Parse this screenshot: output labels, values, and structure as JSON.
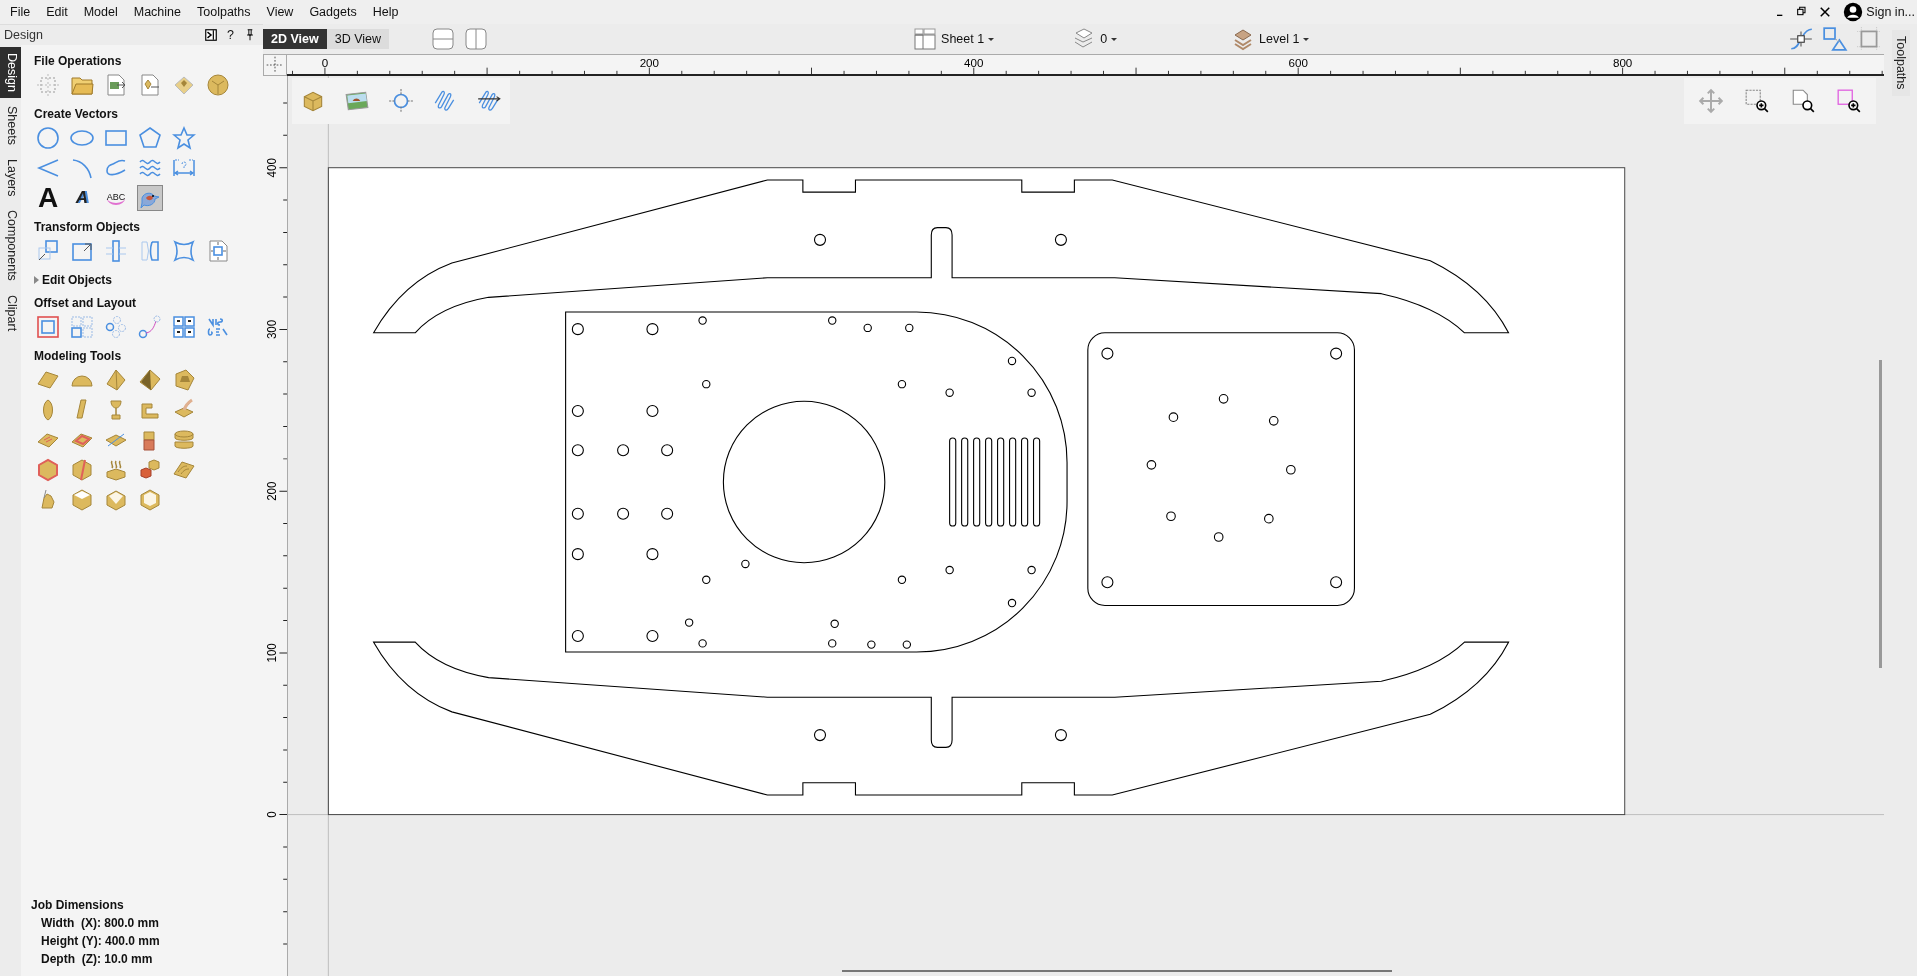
{
  "menu": [
    "File",
    "Edit",
    "Model",
    "Machine",
    "Toolpaths",
    "View",
    "Gadgets",
    "Help"
  ],
  "account": {
    "label": "Sign in..."
  },
  "panel": {
    "title": "Design",
    "help": "?",
    "side_tabs": [
      {
        "label": "Design",
        "selected": true
      },
      {
        "label": "Sheets",
        "selected": false
      },
      {
        "label": "Layers",
        "selected": false
      },
      {
        "label": "Components",
        "selected": false
      },
      {
        "label": "Clipart",
        "selected": false
      }
    ],
    "sections": [
      {
        "title": "File Operations",
        "tools": [
          {
            "selected": false
          },
          {
            "selected": false
          },
          {
            "selected": false
          },
          {
            "selected": false
          },
          {
            "selected": false
          },
          {
            "selected": false
          }
        ]
      },
      {
        "title": "Create Vectors",
        "tools": [
          {
            "selected": false
          },
          {
            "selected": false
          },
          {
            "selected": false
          },
          {
            "selected": false
          },
          {
            "selected": false
          },
          {
            "selected": false
          },
          {
            "selected": false
          },
          {
            "selected": false
          },
          {
            "selected": false
          },
          {
            "selected": false
          },
          {
            "glyph": "A",
            "selected": false
          },
          {
            "glyph": "A",
            "selected": false
          },
          {
            "glyph": "ABC",
            "selected": false
          },
          {
            "selected": true
          }
        ]
      },
      {
        "title": "Transform Objects",
        "tools": [
          {
            "selected": false
          },
          {
            "selected": false
          },
          {
            "selected": false
          },
          {
            "selected": false
          },
          {
            "selected": false
          },
          {
            "selected": false
          }
        ]
      },
      {
        "title": "Edit Objects",
        "expanded": false
      },
      {
        "title": "Offset and Layout",
        "tools": [
          {
            "selected": false
          },
          {
            "selected": false
          },
          {
            "selected": false
          },
          {
            "selected": false
          },
          {
            "selected": false
          },
          {
            "selected": false
          }
        ]
      },
      {
        "title": "Modeling Tools",
        "tools": [
          {
            "selected": false
          },
          {
            "selected": false
          },
          {
            "selected": false
          },
          {
            "selected": false
          },
          {
            "selected": false
          },
          {
            "selected": false
          },
          {
            "selected": false
          },
          {
            "selected": false
          },
          {
            "selected": false
          },
          {
            "selected": false
          },
          {
            "selected": false
          },
          {
            "selected": false
          },
          {
            "selected": false
          },
          {
            "selected": false
          },
          {
            "selected": false
          },
          {
            "selected": false
          },
          {
            "selected": false
          },
          {
            "selected": false
          },
          {
            "selected": false
          },
          {
            "selected": false
          },
          {
            "selected": false
          },
          {
            "selected": false
          },
          {
            "selected": false
          },
          {
            "selected": false
          }
        ]
      }
    ],
    "job_dimensions": {
      "title": "Job Dimensions",
      "lines": [
        "Width  (X): 800.0 mm",
        "Height (Y): 400.0 mm",
        "Depth  (Z): 10.0 mm"
      ]
    }
  },
  "view_tabs": [
    {
      "label": "2D View",
      "selected": true
    },
    {
      "label": "3D View",
      "selected": false
    }
  ],
  "dropdowns": [
    {
      "label": "Sheet 1"
    },
    {
      "label": "0"
    },
    {
      "label": "Level 1"
    }
  ],
  "rulers": {
    "horizontal": [
      "0",
      "200",
      "400",
      "600",
      "800"
    ],
    "vertical": [
      "400",
      "300",
      "200",
      "100",
      "0"
    ]
  },
  "right_tabs": [
    {
      "label": "Toolpaths",
      "selected": false
    }
  ]
}
